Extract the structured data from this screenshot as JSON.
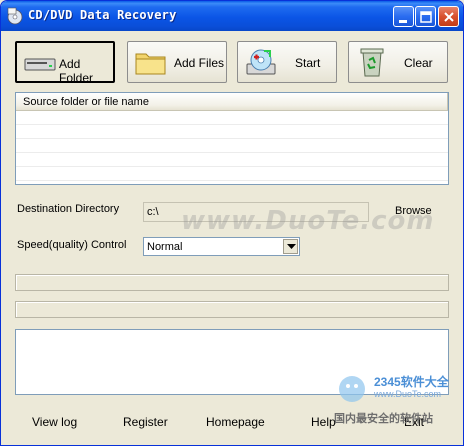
{
  "window": {
    "title": "CD/DVD Data Recovery"
  },
  "toolbar": {
    "add_folder": "Add Folder",
    "add_files": "Add Files",
    "start": "Start",
    "clear": "Clear"
  },
  "source_list": {
    "header": "Source folder or file name",
    "rows": []
  },
  "destination": {
    "label": "Destination Directory",
    "value": "c:\\",
    "browse": "Browse"
  },
  "speed": {
    "label": "Speed(quality) Control",
    "selected": "Normal"
  },
  "progress": {
    "bar1": 0,
    "bar2": 0
  },
  "log": {
    "text": ""
  },
  "bottom": {
    "view_log": "View log",
    "register": "Register",
    "homepage": "Homepage",
    "help": "Help",
    "exit": "Exit"
  },
  "watermarks": {
    "duote": "www.DuoTe.com",
    "brand": "2345软件大全",
    "url": "www.DuoTe.com",
    "cn": "国内最安全的软件站"
  },
  "colors": {
    "titlebar": "#0b55e6",
    "progress_fill": "#2ad04e",
    "face": "#ece9d8"
  }
}
